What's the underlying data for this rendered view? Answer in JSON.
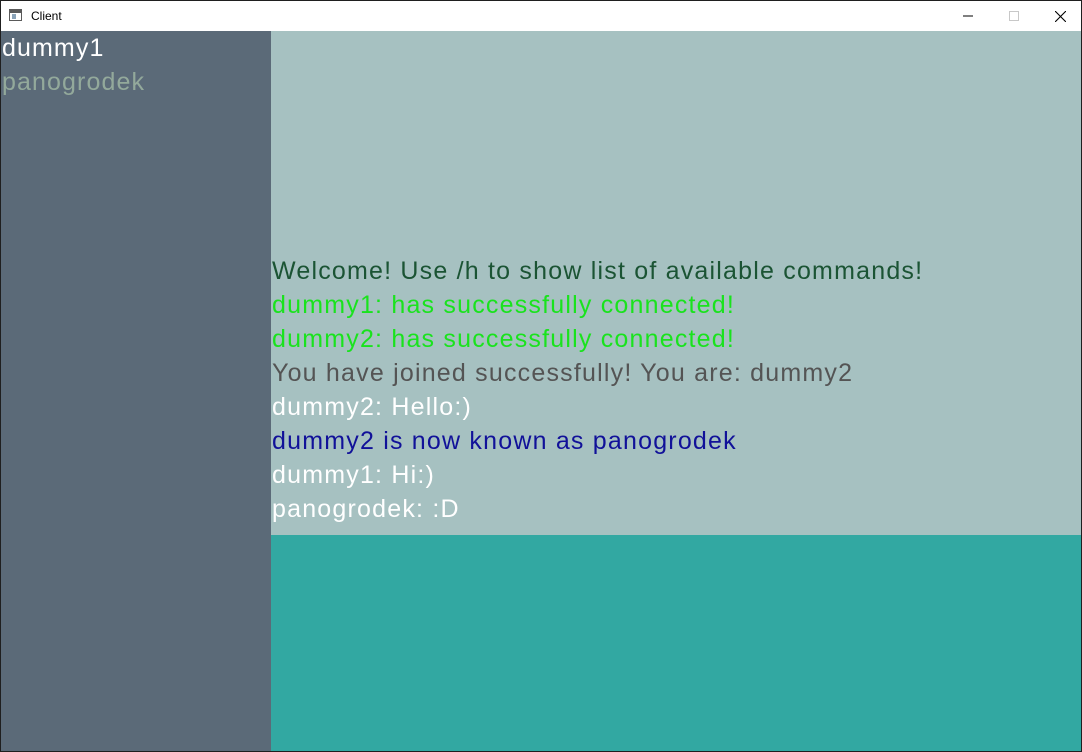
{
  "window": {
    "title": "Client",
    "controls": [
      "minimize",
      "maximize",
      "close"
    ]
  },
  "users": [
    {
      "name": "dummy1",
      "color": "#ffffff"
    },
    {
      "name": "panogrodek",
      "color": "#93a99b"
    }
  ],
  "messages": [
    {
      "text": "Welcome! Use /h to show list of available commands!",
      "color": "#1b5434"
    },
    {
      "text": "dummy1: has successfully connected!",
      "color": "#19e31d"
    },
    {
      "text": "dummy2: has successfully connected!",
      "color": "#19e31d"
    },
    {
      "text": "You have joined successfully! You are: dummy2",
      "color": "#545454"
    },
    {
      "text": "dummy2: Hello:)",
      "color": "#ffffff"
    },
    {
      "text": "dummy2 is now known as panogrodek",
      "color": "#111199"
    },
    {
      "text": "dummy1: Hi:)",
      "color": "#ffffff"
    },
    {
      "text": "panogrodek: :D",
      "color": "#ffffff"
    }
  ],
  "input": {
    "value": ""
  },
  "colors": {
    "sidebar_bg": "#5b6a78",
    "chat_bg": "#a6c1c1",
    "input_bg": "#32a8a2"
  }
}
